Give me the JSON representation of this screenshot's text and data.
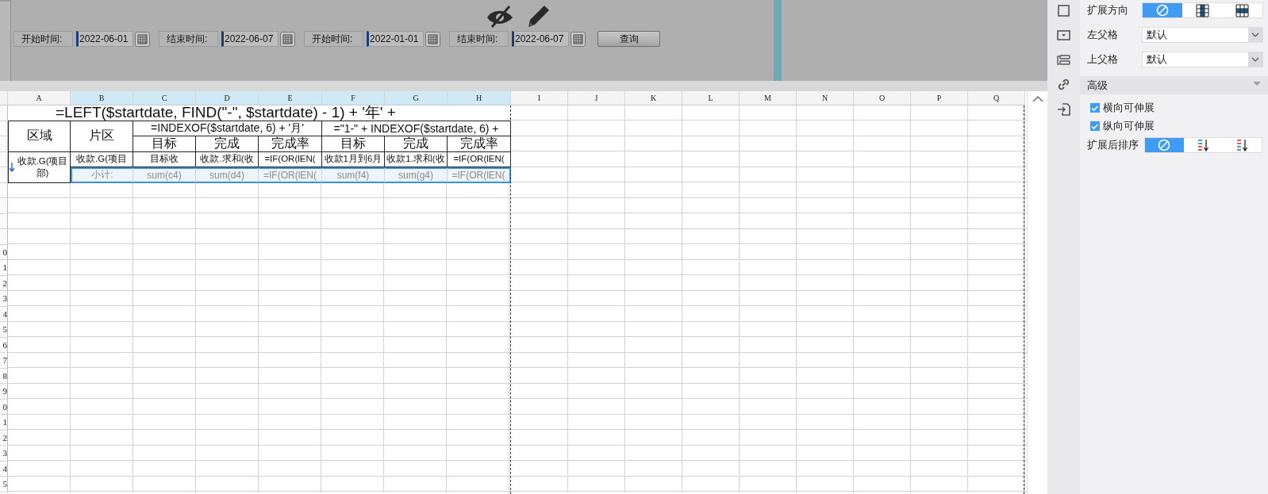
{
  "parameter_bar": {
    "fields": [
      {
        "label": "开始时间:",
        "value": "2022-06-01"
      },
      {
        "label": "结束时间:",
        "value": "2022-06-07"
      },
      {
        "label": "开始时间:",
        "value": "2022-01-01"
      },
      {
        "label": "结束时间:",
        "value": "2022-06-07"
      }
    ],
    "query_button": "查询"
  },
  "sheet": {
    "columns": [
      {
        "label": "A",
        "selected": false
      },
      {
        "label": "B",
        "selected": true
      },
      {
        "label": "C",
        "selected": true
      },
      {
        "label": "D",
        "selected": true
      },
      {
        "label": "E",
        "selected": true
      },
      {
        "label": "F",
        "selected": true
      },
      {
        "label": "G",
        "selected": true
      },
      {
        "label": "H",
        "selected": true
      },
      {
        "label": "I",
        "selected": false
      },
      {
        "label": "J",
        "selected": false
      },
      {
        "label": "K",
        "selected": false
      },
      {
        "label": "L",
        "selected": false
      },
      {
        "label": "M",
        "selected": false
      },
      {
        "label": "N",
        "selected": false
      },
      {
        "label": "O",
        "selected": false
      },
      {
        "label": "P",
        "selected": false
      },
      {
        "label": "Q",
        "selected": false
      }
    ],
    "row_labels": [
      "0",
      "1",
      "2",
      "3",
      "4",
      "5",
      "6",
      "7",
      "8",
      "9",
      "0",
      "1",
      "2",
      "3",
      "4",
      "5"
    ],
    "title": "=LEFT($startdate, FIND(\"-\", $startdate) - 1) + '年' +",
    "header": {
      "region": "区域",
      "area": "片区",
      "groups": [
        {
          "title": "=INDEXOF($startdate, 6) + '月'",
          "columns": [
            "目标",
            "完成",
            "完成率"
          ]
        },
        {
          "title": "=\"1-\" + INDEXOF($startdate, 6) +",
          "columns": [
            "目标",
            "完成",
            "完成率"
          ]
        }
      ]
    },
    "data_row": {
      "region": "收款.G(项目部)",
      "expand_down": true,
      "cells": [
        "收款.G(项目",
        "目标收",
        "收款.求和(收",
        "=IF(OR(lEN(",
        "收款1月到6月",
        "收款1.求和(收",
        "=IF(OR(lEN("
      ]
    },
    "subtotal_row": {
      "selected": true,
      "cells": [
        "小计:",
        "sum(c4)",
        "sum(d4)",
        "=IF(OR(lEN(",
        "sum(f4)",
        "sum(g4)",
        "=IF(OR(lEN("
      ]
    }
  },
  "property_panel": {
    "expand_direction": {
      "label": "扩展方向",
      "options": [
        {
          "kind": "none",
          "selected": true
        },
        {
          "kind": "vertical",
          "selected": false
        },
        {
          "kind": "horizontal",
          "selected": false
        }
      ]
    },
    "dropdowns": [
      {
        "label": "左父格",
        "value": "默认"
      },
      {
        "label": "上父格",
        "value": "默认"
      }
    ],
    "section": {
      "title": "高级",
      "expanded": true
    },
    "checkboxes": [
      {
        "label": "横向可伸展",
        "checked": true
      },
      {
        "label": "纵向可伸展",
        "checked": true
      }
    ],
    "sort": {
      "label": "扩展后排序",
      "options": [
        {
          "kind": "none",
          "selected": true
        },
        {
          "kind": "ascending",
          "selected": false
        },
        {
          "kind": "descending",
          "selected": false
        }
      ]
    }
  }
}
